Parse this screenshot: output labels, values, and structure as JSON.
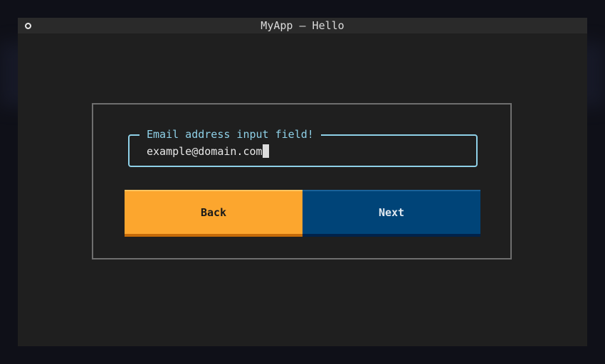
{
  "window": {
    "title": "MyApp — Hello"
  },
  "form": {
    "email_field": {
      "legend": "Email address input field!",
      "value": "example@domain.com"
    },
    "back_label": "Back",
    "next_label": "Next"
  },
  "colors": {
    "accent_border": "#8fd1e8",
    "back_button": "#fca62e",
    "next_button": "#004478",
    "window_bg": "#1f1f1f"
  }
}
